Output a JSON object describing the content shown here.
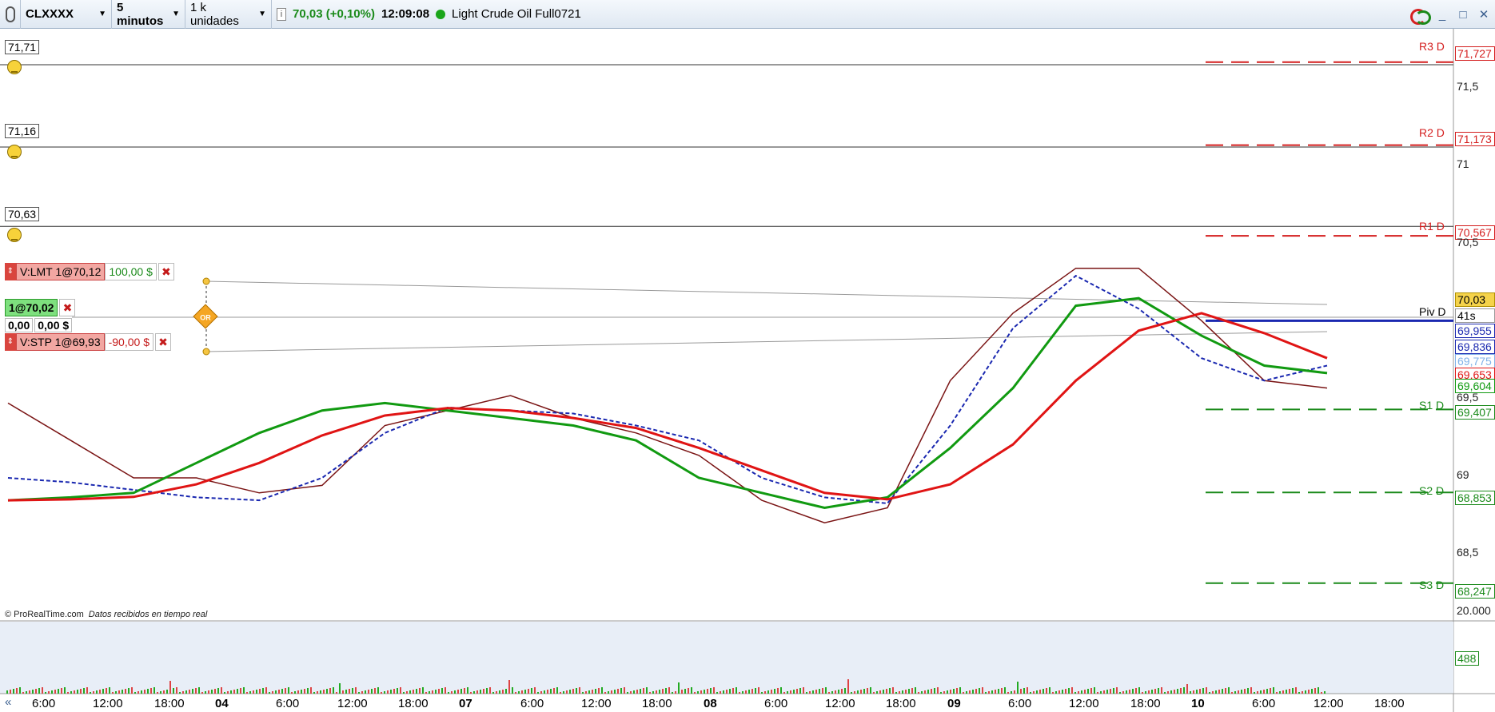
{
  "toolbar": {
    "symbol": "CLXXXX",
    "interval": "5 minutos",
    "units": "1 k unidades",
    "info_icon": "i",
    "price_change": "70,03 (+0,10%)",
    "time": "12:09:08",
    "instrument": "Light Crude Oil Full0721",
    "minimize": "_",
    "maximize": "□",
    "close": "✕"
  },
  "colors": {
    "ma_green": "#119a11",
    "ma_red": "#e01414",
    "price_dark": "#7a1414",
    "blue_step": "#1a28b0",
    "pivot_red": "#d41e1e",
    "pivot_green": "#1a8a1a",
    "panel_bg": "#e8eef7"
  },
  "price_levels": [
    {
      "label": "71,71",
      "value": 71.71
    },
    {
      "label": "71,16",
      "value": 71.16
    },
    {
      "label": "70,63",
      "value": 70.63
    }
  ],
  "orders": {
    "limit": {
      "label": "V:LMT 1@70,12",
      "amount": "100,00 $"
    },
    "position": {
      "label": "1@70,02",
      "pnl": [
        "0,00",
        "0,00 $"
      ]
    },
    "stop": {
      "label": "V:STP 1@69,93",
      "amount": "-90,00 $"
    },
    "or_tag": "OR"
  },
  "pivots": [
    {
      "name": "R3 D",
      "value": "71,727",
      "y": 71.727,
      "color": "red"
    },
    {
      "name": "R2 D",
      "value": "71,173",
      "y": 71.173,
      "color": "red"
    },
    {
      "name": "R1 D",
      "value": "70,567",
      "y": 70.567,
      "color": "red"
    },
    {
      "name": "Piv D",
      "value": "69,955",
      "y": 70.0,
      "color": "black"
    },
    {
      "name": "S1 D",
      "value": "69,407",
      "y": 69.407,
      "color": "green"
    },
    {
      "name": "S2 D",
      "value": "68,853",
      "y": 68.853,
      "color": "green"
    },
    {
      "name": "S3 D",
      "value": "68,247",
      "y": 68.247,
      "color": "green"
    }
  ],
  "price_axis": {
    "ticks": [
      "71,5",
      "71",
      "70,5",
      "69,5",
      "69",
      "68,5"
    ],
    "tick_values": [
      71.5,
      71.0,
      70.5,
      69.5,
      69.0,
      68.5
    ],
    "last_price": "70,03",
    "countdown": "41s",
    "ma_values": [
      {
        "label": "69,836",
        "y": 69.836,
        "color": "#1a28b0"
      },
      {
        "label": "69,775",
        "y": 69.775,
        "color": "#7fb2e8"
      },
      {
        "label": "69,653",
        "y": 69.653,
        "color": "#e01414"
      },
      {
        "label": "69,604",
        "y": 69.604,
        "color": "#119a11"
      }
    ]
  },
  "volume_axis": {
    "tick": "20.000",
    "last": "488"
  },
  "time_axis": {
    "labels": [
      "6:00",
      "12:00",
      "18:00",
      "04",
      "6:00",
      "12:00",
      "18:00",
      "07",
      "6:00",
      "12:00",
      "18:00",
      "08",
      "6:00",
      "12:00",
      "18:00",
      "09",
      "6:00",
      "12:00",
      "18:00",
      "10",
      "6:00",
      "12:00",
      "18:00"
    ],
    "bold": [
      "04",
      "07",
      "08",
      "09",
      "10"
    ]
  },
  "credit": {
    "source": "© ProRealTime.com",
    "note": "Datos recibidos en tiempo real"
  },
  "nav": {
    "scroll_left": "«"
  },
  "chart_data": {
    "type": "line",
    "title": "",
    "x": [
      "6:00",
      "12:00",
      "18:00",
      "04",
      "6:00",
      "12:00",
      "18:00",
      "07",
      "6:00",
      "12:00",
      "18:00",
      "08",
      "6:00",
      "12:00",
      "18:00",
      "09",
      "6:00",
      "12:00",
      "18:00",
      "10",
      "6:00",
      "12:00"
    ],
    "ylim": [
      68.0,
      71.95
    ],
    "grid": false,
    "series": [
      {
        "values": [
          69.45,
          69.2,
          68.95,
          68.95,
          68.85,
          68.9,
          69.3,
          69.4,
          69.5,
          69.35,
          69.25,
          69.1,
          68.8,
          68.65,
          68.75,
          69.6,
          70.05,
          70.35,
          70.35,
          70.0,
          69.6,
          69.55
        ]
      },
      {
        "values": [
          68.95,
          68.92,
          68.87,
          68.82,
          68.8,
          68.95,
          69.25,
          69.42,
          69.4,
          69.38,
          69.3,
          69.2,
          68.95,
          68.82,
          68.78,
          69.3,
          69.95,
          70.3,
          70.08,
          69.75,
          69.6,
          69.7
        ]
      },
      {
        "values": [
          68.8,
          68.82,
          68.85,
          69.05,
          69.25,
          69.4,
          69.45,
          69.4,
          69.35,
          69.3,
          69.2,
          68.95,
          68.85,
          68.75,
          68.82,
          69.15,
          69.55,
          70.1,
          70.15,
          69.9,
          69.7,
          69.65
        ]
      }
    ]
  }
}
